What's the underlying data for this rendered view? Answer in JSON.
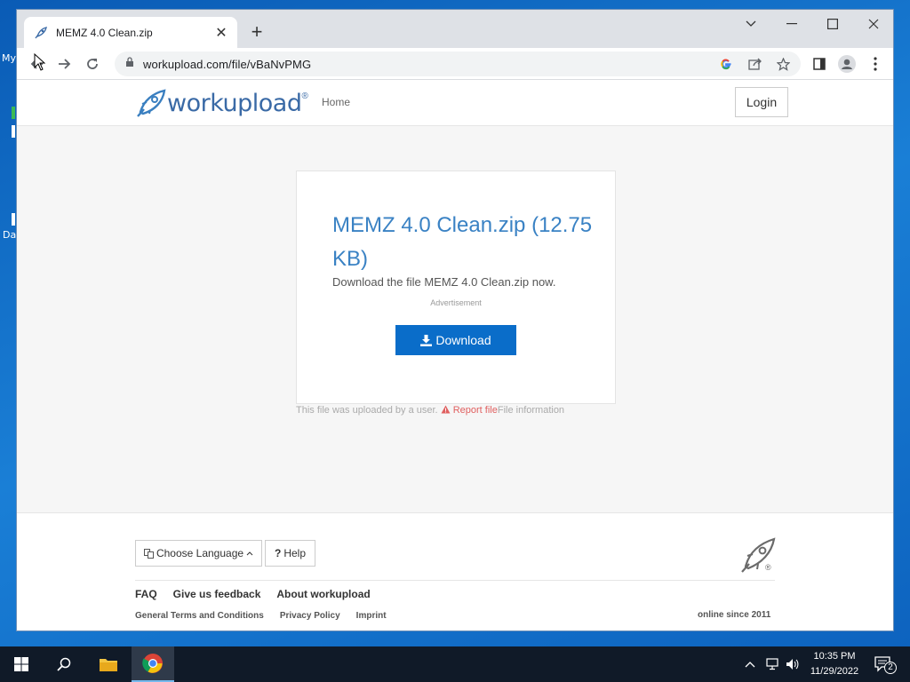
{
  "desktop": {
    "icon_label_1": "My",
    "icon_label_2": "Da"
  },
  "browser": {
    "tab_title": "MEMZ 4.0 Clean.zip",
    "tab_close": "✕",
    "new_tab": "+",
    "url": "workupload.com/file/vBaNvPMG",
    "window_controls": [
      "chevron-down-icon",
      "minimize-icon",
      "maximize-icon",
      "close-icon"
    ]
  },
  "site": {
    "logo_text": "workupload",
    "logo_reg": "®",
    "nav_home": "Home",
    "login": "Login",
    "file_title": "MEMZ 4.0 Clean.zip (12.75 KB)",
    "file_desc": "Download the file MEMZ 4.0 Clean.zip now.",
    "ad_label": "Advertisement",
    "download_label": "Download",
    "uploaded_by": "This file was uploaded by a user.",
    "report_file": "Report file",
    "file_info": "File information"
  },
  "footer": {
    "choose_language": "Choose Language",
    "help": "Help",
    "links": [
      "FAQ",
      "Give us feedback",
      "About workupload"
    ],
    "small_links": [
      "General Terms and Conditions",
      "Privacy Policy",
      "Imprint"
    ],
    "online_since": "online since 2011",
    "rocket_reg": "®"
  },
  "taskbar": {
    "time": "10:35 PM",
    "date": "11/29/2022",
    "notification_count": "2"
  },
  "colors": {
    "accent": "#3a82c4",
    "download_button": "#0a6dc9",
    "report_link": "#e06060",
    "taskbar": "#101a28"
  }
}
